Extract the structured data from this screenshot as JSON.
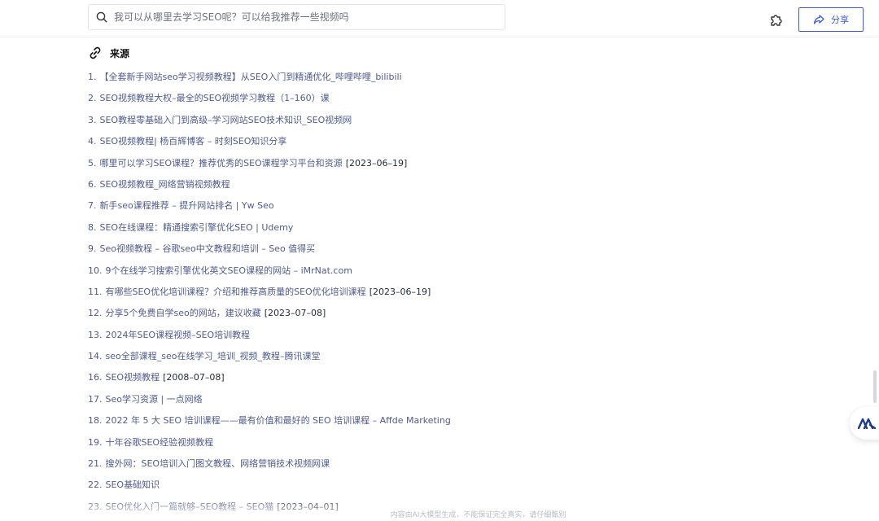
{
  "search": {
    "placeholder": "我可以从哪里去学习SEO呢？可以给我推荐一些视频吗",
    "value": ""
  },
  "header": {
    "share_label": "分享",
    "accent_color": "#3b5bdb"
  },
  "sources": {
    "title": "来源",
    "items": [
      {
        "num": "1.",
        "text": "【全套新手网站seo学习视频教程】从SEO入门到精通优化_哔哩哔哩_bilibili",
        "date": ""
      },
      {
        "num": "2.",
        "text": "SEO视频教程大权–最全的SEO视频学习教程（1–160）课",
        "date": ""
      },
      {
        "num": "3.",
        "text": "SEO教程零基础入门到高级–学习网站SEO技术知识_SEO视频网",
        "date": ""
      },
      {
        "num": "4.",
        "text": "SEO视频教程| 杨百辉博客 – 时刻SEO知识分享",
        "date": ""
      },
      {
        "num": "5.",
        "text": "哪里可以学习SEO课程？推荐优秀的SEO课程学习平台和资源",
        "date": "[2023–06–19]"
      },
      {
        "num": "6.",
        "text": "SEO视频教程_网络营销视频教程",
        "date": ""
      },
      {
        "num": "7.",
        "text": "新手seo课程推荐 – 提升网站排名 | Yw Seo",
        "date": ""
      },
      {
        "num": "8.",
        "text": "SEO在线课程：精通搜索引擎优化SEO | Udemy",
        "date": ""
      },
      {
        "num": "9.",
        "text": "Seo视频教程 – 谷歌seo中文教程和培训 – Seo 值得买",
        "date": ""
      },
      {
        "num": "10.",
        "text": "9个在线学习搜索引擎优化英文SEO课程的网站 – iMrNat.com",
        "date": ""
      },
      {
        "num": "11.",
        "text": "有哪些SEO优化培训课程？介绍和推荐高质量的SEO优化培训课程",
        "date": "[2023–06–19]"
      },
      {
        "num": "12.",
        "text": "分享5个免费自学seo的网站，建议收藏",
        "date": "[2023–07–08]"
      },
      {
        "num": "13.",
        "text": "2024年SEO课程视频–SEO培训教程",
        "date": ""
      },
      {
        "num": "14.",
        "text": "seo全部课程_seo在线学习_培训_视频_教程–腾讯课堂",
        "date": ""
      },
      {
        "num": "16.",
        "text": "SEO视频教程",
        "date": "[2008–07–08]"
      },
      {
        "num": "17.",
        "text": "Seo学习资源 | 一点网络",
        "date": ""
      },
      {
        "num": "18.",
        "text": "2022 年 5 大 SEO 培训课程——最有价值和最好的 SEO 培训课程 – Affde Marketing",
        "date": ""
      },
      {
        "num": "19.",
        "text": "十年谷歌SEO经验视频教程",
        "date": ""
      },
      {
        "num": "21.",
        "text": "搜外网：SEO培训入门图文教程、网络营销技术视频网课",
        "date": ""
      },
      {
        "num": "22.",
        "text": "SEO基础知识",
        "date": ""
      },
      {
        "num": "23.",
        "text": "SEO优化入门一篇就够–SEO教程 – SEO猫",
        "date": "[2023–04–01]"
      }
    ]
  },
  "footer": {
    "disclaimer": "内容由AI大模型生成，不能保证完全真实，请仔细甄别"
  }
}
